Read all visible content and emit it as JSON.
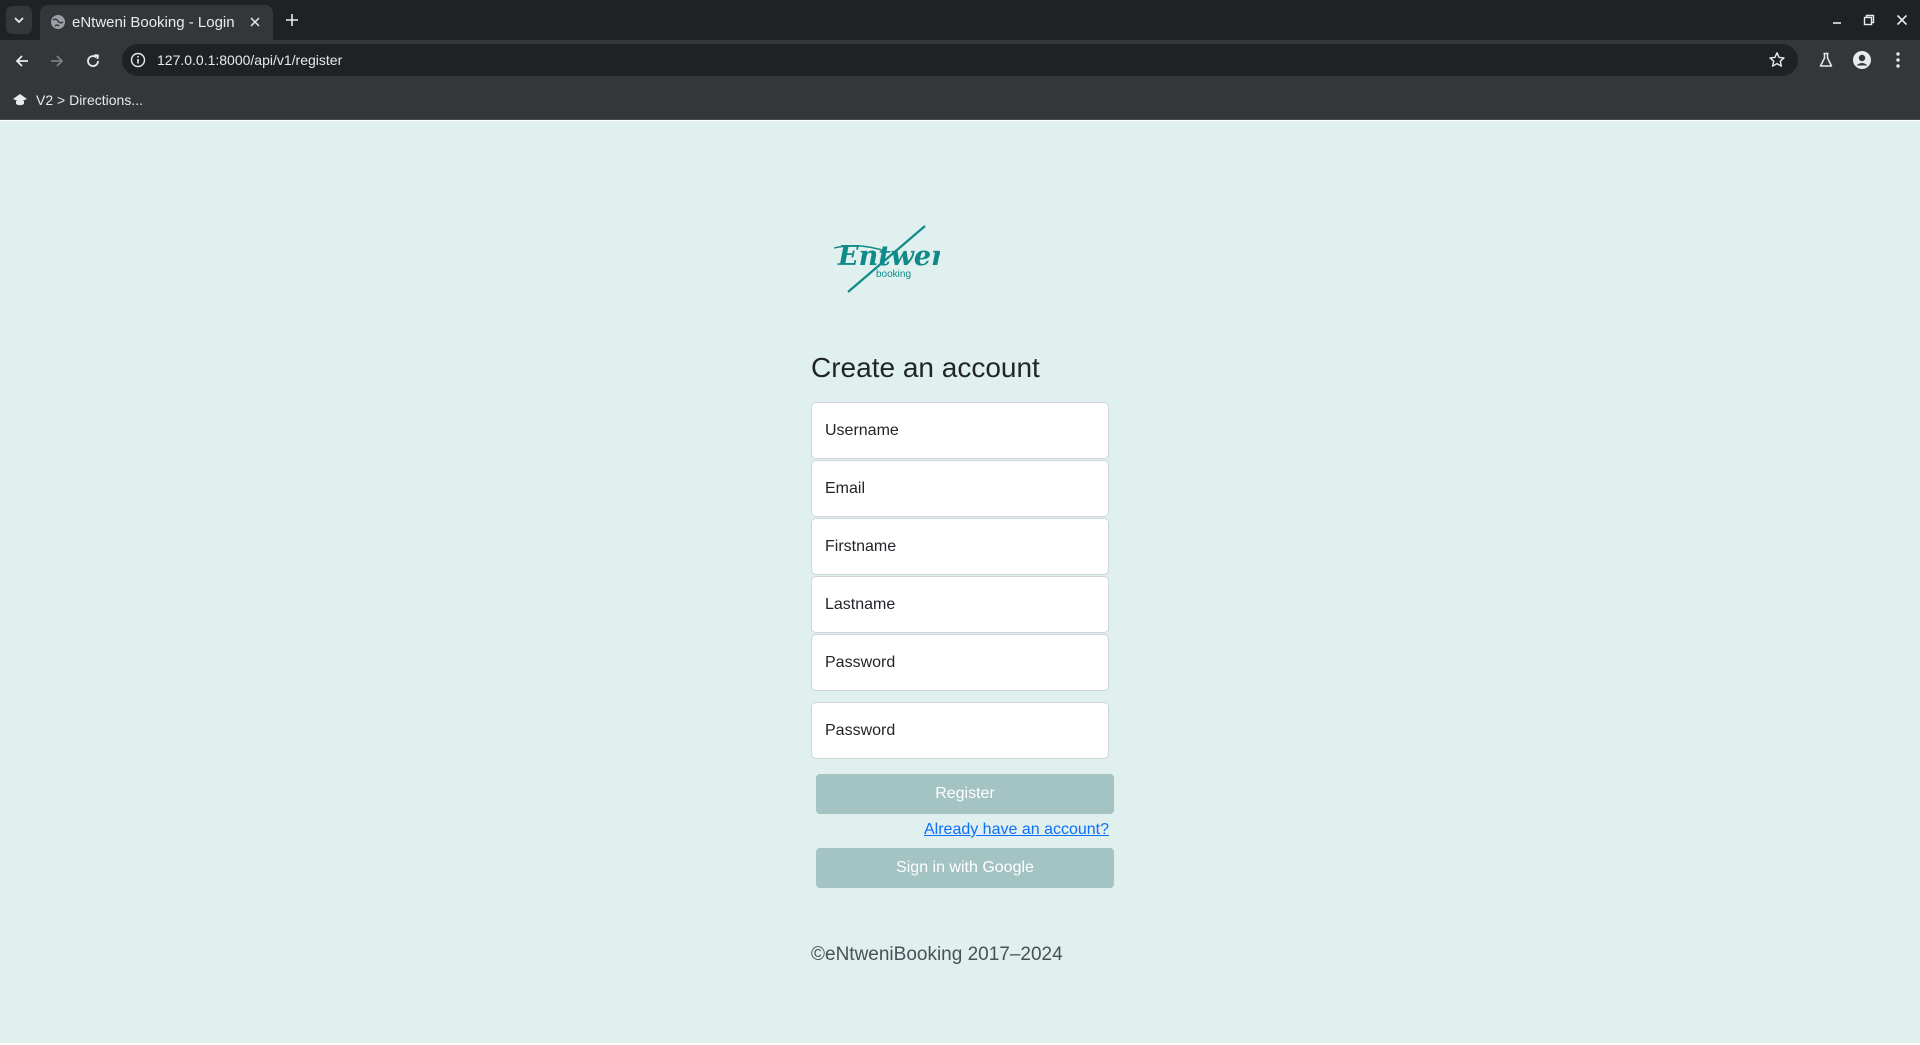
{
  "browser": {
    "tab_title": "eNtweni Booking - Login",
    "url": "127.0.0.1:8000/api/v1/register",
    "bookmark_label": "V2 > Directions..."
  },
  "page": {
    "logo": {
      "script_text": "Entweni",
      "sub_text": "booking",
      "color": "#0f8a88"
    },
    "heading": "Create an account",
    "fields": {
      "username_placeholder": "Username",
      "email_placeholder": "Email",
      "firstname_placeholder": "Firstname",
      "lastname_placeholder": "Lastname",
      "password_placeholder": "Password",
      "confirm_password_placeholder": "Password"
    },
    "register_label": "Register",
    "login_link_label": "Already have an account?",
    "google_label": "Sign in with Google",
    "footer_text": "©eNtweniBooking 2017–2024"
  },
  "colors": {
    "page_background": "#dff0ef",
    "button_background": "#a4c3c3",
    "link": "#0d6efd"
  }
}
